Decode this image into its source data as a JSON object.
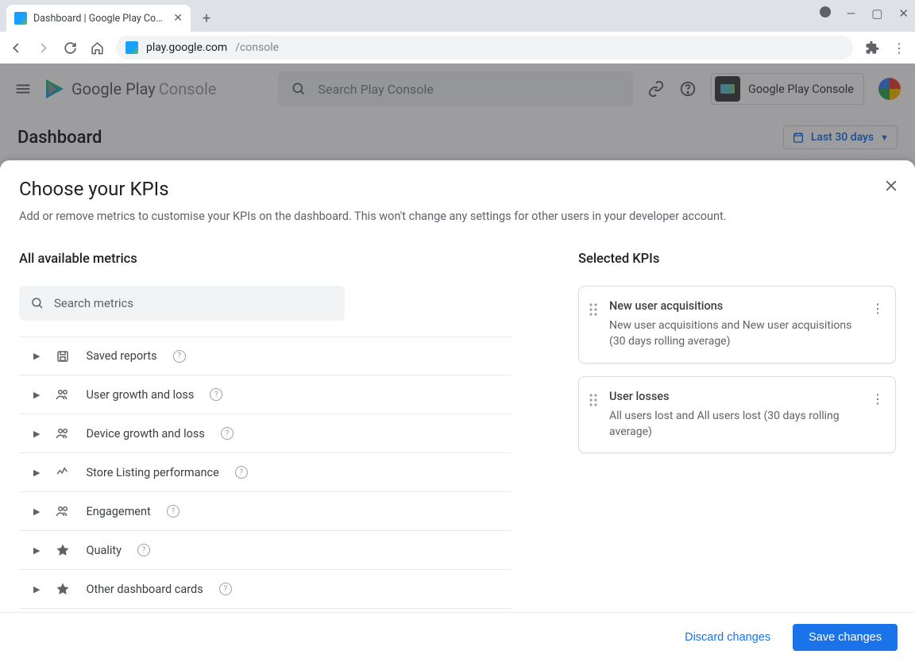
{
  "browser": {
    "tab_title": "Dashboard | Google Play Console",
    "url_host": "play.google.com",
    "url_path": "/console"
  },
  "app_header": {
    "brand_1": "Google Play",
    "brand_2": "Console",
    "search_placeholder": "Search Play Console",
    "app_name": "Google Play Console"
  },
  "page": {
    "title": "Dashboard",
    "date_range": "Last 30 days"
  },
  "modal": {
    "title": "Choose your KPIs",
    "subtitle": "Add or remove metrics to customise your KPIs on the dashboard. This won't change any settings for other users in your developer account.",
    "left_heading": "All available metrics",
    "right_heading": "Selected KPIs",
    "search_placeholder": "Search metrics",
    "metrics": [
      {
        "label": "Saved reports",
        "icon": "save"
      },
      {
        "label": "User growth and loss",
        "icon": "group"
      },
      {
        "label": "Device growth and loss",
        "icon": "group"
      },
      {
        "label": "Store Listing performance",
        "icon": "spark"
      },
      {
        "label": "Engagement",
        "icon": "group"
      },
      {
        "label": "Quality",
        "icon": "star"
      },
      {
        "label": "Other dashboard cards",
        "icon": "star"
      }
    ],
    "selected": [
      {
        "title": "New user acquisitions",
        "desc": "New user acquisitions and New user acquisitions (30 days rolling average)"
      },
      {
        "title": "User losses",
        "desc": "All users lost and All users lost (30 days rolling average)"
      }
    ],
    "discard": "Discard changes",
    "save": "Save changes"
  }
}
